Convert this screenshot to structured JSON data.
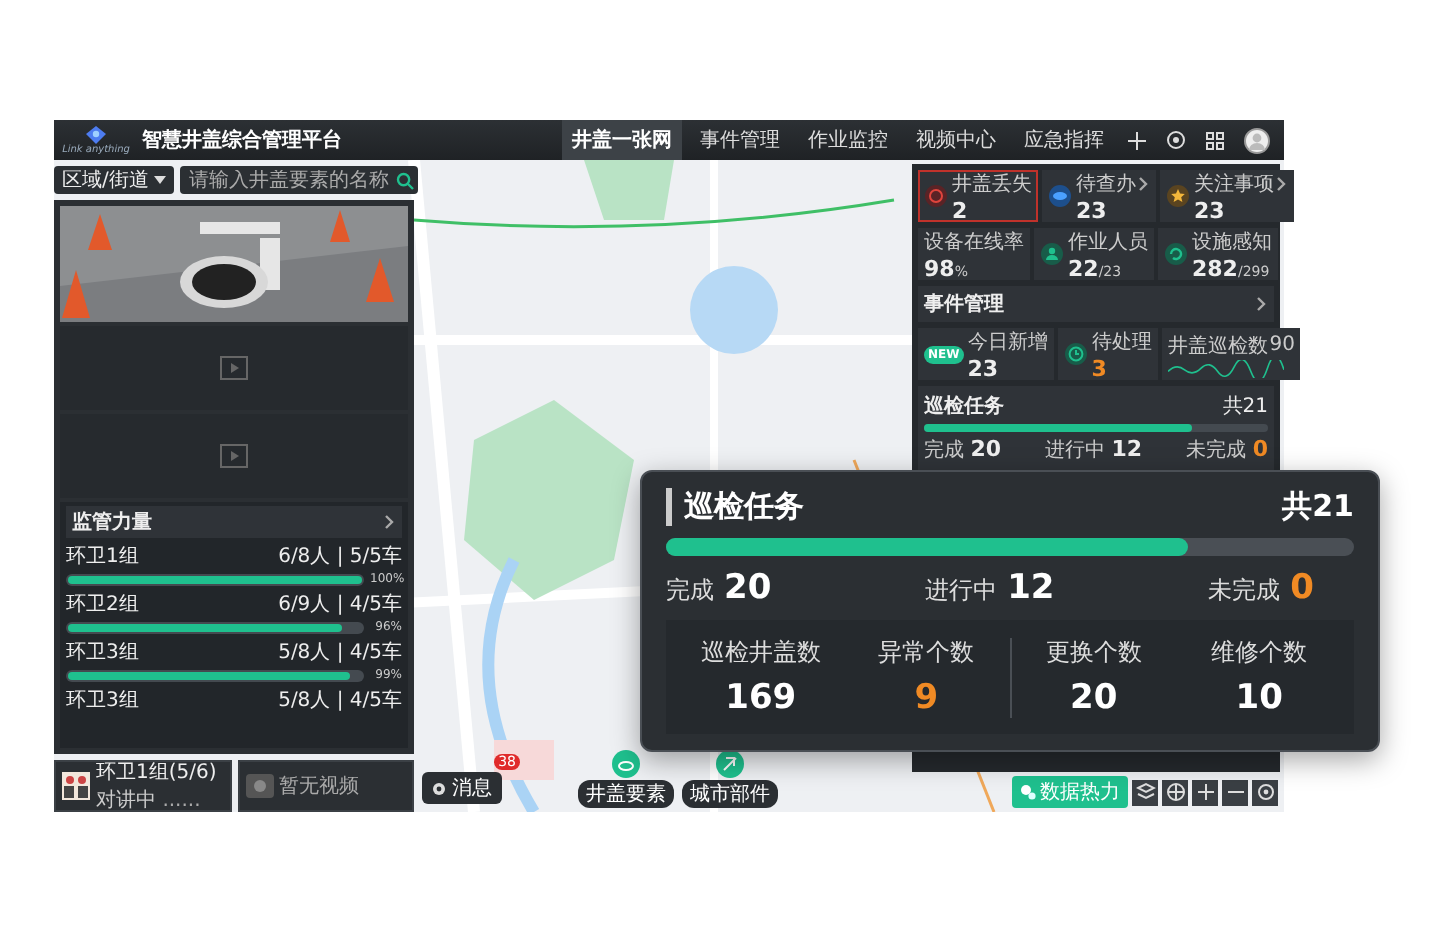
{
  "app": {
    "logo_text": "Link anything",
    "title": "智慧井盖综合管理平台"
  },
  "nav": [
    {
      "label": "井盖一张网",
      "selected": true
    },
    {
      "label": "事件管理",
      "selected": false
    },
    {
      "label": "作业监控",
      "selected": false
    },
    {
      "label": "视频中心",
      "selected": false
    },
    {
      "label": "应急指挥",
      "selected": false
    }
  ],
  "filters": {
    "region": "区域/街道",
    "search": {
      "placeholder": "请输入井盖要素的名称"
    }
  },
  "video_slots": [
    {
      "kind": "picture"
    },
    {
      "kind": "empty"
    },
    {
      "kind": "empty"
    }
  ],
  "supervision": {
    "title": "监管力量",
    "teams": [
      {
        "name": "环卫1组",
        "staff": "6/8人 | 5/5车",
        "level": 1.0,
        "percent": "100%"
      },
      {
        "name": "环卫2组",
        "staff": "6/9人 | 4/5车",
        "level": 0.93,
        "percent": "96%"
      },
      {
        "name": "环卫3组",
        "staff": "5/8人 | 4/5车",
        "level": 0.96,
        "percent": "99%"
      },
      {
        "name": "环卫3组",
        "staff": "5/8人 | 4/5车"
      }
    ]
  },
  "bottom_cards": [
    {
      "kind": "call",
      "title": "环卫1组(5/6)",
      "status": "对讲中",
      "dots": "......"
    },
    {
      "kind": "video",
      "title": "暂无视频"
    }
  ],
  "message_button": {
    "label": "消息",
    "badge": "38"
  },
  "map_buttons": [
    {
      "kind": "cover",
      "label": "井盖要素"
    },
    {
      "kind": "parts",
      "label": "城市部件"
    }
  ],
  "map_controls": {
    "heat_button": "数据热力"
  },
  "summary": [
    {
      "kind": "lost",
      "label": "井盖丢失",
      "value": "2",
      "arrow": false,
      "alert": true
    },
    {
      "kind": "todo",
      "label": "待查办",
      "value": "23",
      "arrow": true,
      "alert": false
    },
    {
      "kind": "focus",
      "label": "关注事项",
      "value": "23",
      "arrow": true,
      "alert": false
    }
  ],
  "metrics": [
    {
      "kind": "rate",
      "label": "设备在线率",
      "value": "98",
      "unit": "%"
    },
    {
      "kind": "staff",
      "label": "作业人员",
      "value": "22",
      "unit": "/23"
    },
    {
      "kind": "sensor",
      "label": "设施感知",
      "value": "282",
      "unit": "/299"
    }
  ],
  "events": {
    "title": "事件管理",
    "items": [
      {
        "kind": "new",
        "badge": "NEW",
        "label": "今日新增",
        "value": "23",
        "warn": false
      },
      {
        "kind": "pending",
        "label": "待处理",
        "value": "3",
        "warn": true
      },
      {
        "kind": "trend",
        "label": "井盖巡检数",
        "value": "90",
        "warn": false
      }
    ]
  },
  "patrol_mini": {
    "title": "巡检任务",
    "total": "共21",
    "level": 0.78,
    "stats": [
      {
        "label": "完成",
        "value": "20",
        "warn": false
      },
      {
        "label": "进行中",
        "value": "12",
        "warn": false
      },
      {
        "label": "未完成",
        "value": "0",
        "warn": true
      }
    ]
  },
  "patrol_card": {
    "title": "巡检任务",
    "total": "共21",
    "level": 0.76,
    "stats": [
      {
        "label": "完成",
        "value": "20",
        "warn": false
      },
      {
        "label": "进行中",
        "value": "12",
        "warn": false
      },
      {
        "label": "未完成",
        "value": "0",
        "warn": true
      }
    ],
    "details": [
      {
        "label": "巡检井盖数",
        "value": "169",
        "warn": false
      },
      {
        "label": "异常个数",
        "value": "9",
        "warn": true
      },
      {
        "label": "更换个数",
        "value": "20",
        "warn": false
      },
      {
        "label": "维修个数",
        "value": "10",
        "warn": false
      }
    ]
  }
}
